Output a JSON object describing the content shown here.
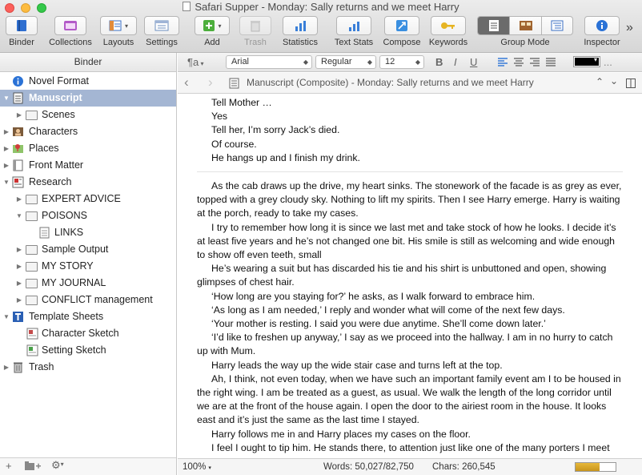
{
  "window": {
    "title": "Safari Supper - Monday: Sally returns and we meet Harry"
  },
  "toolbar": {
    "binder": "Binder",
    "collections": "Collections",
    "layouts": "Layouts",
    "settings": "Settings",
    "add": "Add",
    "trash": "Trash",
    "statistics": "Statistics",
    "text_stats": "Text Stats",
    "compose": "Compose",
    "keywords": "Keywords",
    "group_mode": "Group Mode",
    "inspector": "Inspector",
    "overflow": "»"
  },
  "binder": {
    "header": "Binder",
    "items": [
      {
        "label": "Novel Format",
        "icon": "info-icon"
      },
      {
        "label": "Manuscript",
        "icon": "manuscript-icon"
      },
      {
        "label": "Scenes",
        "icon": "folder-icon"
      },
      {
        "label": "Characters",
        "icon": "characters-icon"
      },
      {
        "label": "Places",
        "icon": "places-icon"
      },
      {
        "label": "Front Matter",
        "icon": "book-icon"
      },
      {
        "label": "Research",
        "icon": "research-icon"
      },
      {
        "label": "EXPERT ADVICE",
        "icon": "folder-icon"
      },
      {
        "label": "POISONS",
        "icon": "folder-icon"
      },
      {
        "label": "LINKS",
        "icon": "document-icon"
      },
      {
        "label": "Sample Output",
        "icon": "folder-icon"
      },
      {
        "label": "MY STORY",
        "icon": "folder-icon"
      },
      {
        "label": "MY JOURNAL",
        "icon": "folder-icon"
      },
      {
        "label": "CONFLICT management",
        "icon": "folder-icon"
      },
      {
        "label": "Template Sheets",
        "icon": "template-icon"
      },
      {
        "label": "Character Sketch",
        "icon": "character-sheet-icon"
      },
      {
        "label": "Setting Sketch",
        "icon": "setting-sheet-icon"
      },
      {
        "label": "Trash",
        "icon": "trash-icon"
      }
    ]
  },
  "format_bar": {
    "paragraph_style": "¶a",
    "font": "Arial",
    "font_style": "Regular",
    "font_size": "12",
    "bold": "B",
    "italic": "I",
    "underline": "U",
    "more": "...",
    "text_color": "#000000"
  },
  "editor": {
    "title": "Manuscript (Composite) - Monday: Sally returns and we meet Harry",
    "dialogue_lines": [
      "Tell Mother …",
      "Yes",
      "Tell her, I’m sorry Jack’s died.",
      "Of course.",
      "He hangs up and I finish my drink."
    ],
    "paragraphs": [
      "As the cab draws up the drive, my heart sinks. The stonework of the facade is as grey as ever, topped with a grey cloudy sky. Nothing to lift my spirits. Then I see Harry emerge. Harry is waiting at the porch, ready to take my cases.",
      "I try to remember how long it is since we last met and take stock of how he looks. I decide it’s at least five years and he’s not changed one bit. His smile is still as welcoming and wide enough to show off even teeth, small",
      "He’s wearing a suit but has discarded his tie and his shirt is unbuttoned and open, showing glimpses of chest hair.",
      "‘How long are you staying for?’ he asks, as I walk forward to embrace him.",
      "‘As long as I am needed,’ I reply and wonder what will come of the next few days.",
      "‘Your mother is resting. I said you were due anytime. She’ll come down later.’",
      "‘I’d like to freshen up anyway,’ I say as we proceed into the hallway. I am in no hurry to catch up with Mum.",
      "Harry leads the way up the wide stair case and turns left at the top.",
      "Ah, I think, not even today, when we have such an important family event am I to be housed in the right wing. I am be treated as a guest, as usual. We walk the length of the long corridor until we are at the front of the house again. I open the door to the airiest room in the house. It looks east and it’s just the same as the last time I stayed.",
      "Harry follows me in  and Harry places my cases on the floor.",
      "I feel I ought to tip him. He stands there, to attention just like one of the many porters I meet on"
    ]
  },
  "status": {
    "zoom": "100%",
    "words": "Words: 50,027/82,750",
    "chars": "Chars: 260,545",
    "progress_fraction": 0.605,
    "progress_color": "#d4a42a"
  },
  "colors": {
    "selection": "#a4b6d3",
    "accent": "#1f6ed4"
  }
}
